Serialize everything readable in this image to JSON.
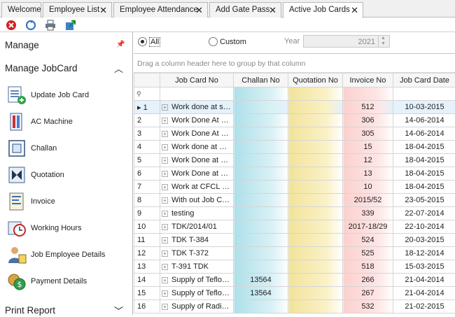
{
  "tabs": [
    {
      "label": "Welcome"
    },
    {
      "label": "Employee List"
    },
    {
      "label": "Employee Attendance"
    },
    {
      "label": "Add Gate Pass"
    },
    {
      "label": "Active Job Cards"
    }
  ],
  "sidebar": {
    "title": "Manage",
    "group": "Manage JobCard",
    "items": [
      {
        "label": "Update Job Card",
        "icon": "update-job-card-icon"
      },
      {
        "label": "AC Machine",
        "icon": "ac-machine-icon"
      },
      {
        "label": "Challan",
        "icon": "challan-icon"
      },
      {
        "label": "Quotation",
        "icon": "quotation-icon"
      },
      {
        "label": "Invoice",
        "icon": "invoice-icon"
      },
      {
        "label": "Working Hours",
        "icon": "working-hours-icon"
      },
      {
        "label": "Job Employee Details",
        "icon": "job-employee-details-icon"
      },
      {
        "label": "Payment Details",
        "icon": "payment-details-icon"
      }
    ],
    "print_report": "Print Report"
  },
  "filter": {
    "all_label": "All",
    "custom_label": "Custom",
    "year_label": "Year",
    "year_value": "2021",
    "selected": "All"
  },
  "grid": {
    "group_hint": "Drag a column header here to group by that column",
    "columns": [
      "Job Card No",
      "Challan No",
      "Quotation No",
      "Invoice No",
      "Job Card Date"
    ],
    "rows": [
      {
        "n": "1",
        "jc": "Work done at site",
        "ch": "",
        "qu": "",
        "inv": "512",
        "date": "10-03-2015"
      },
      {
        "n": "2",
        "jc": "Work Done At Plant",
        "ch": "",
        "qu": "",
        "inv": "306",
        "date": "14-06-2014"
      },
      {
        "n": "3",
        "jc": "Work Done At Plant",
        "ch": "",
        "qu": "",
        "inv": "305",
        "date": "14-06-2014"
      },
      {
        "n": "4",
        "jc": "Work done at CFCL",
        "ch": "",
        "qu": "",
        "inv": "15",
        "date": "18-04-2015"
      },
      {
        "n": "5",
        "jc": "Work Done at CFCL",
        "ch": "",
        "qu": "",
        "inv": "12",
        "date": "18-04-2015"
      },
      {
        "n": "6",
        "jc": "Work Done at CFCL",
        "ch": "",
        "qu": "",
        "inv": "13",
        "date": "18-04-2015"
      },
      {
        "n": "7",
        "jc": "Work at CFCL Site",
        "ch": "",
        "qu": "",
        "inv": "10",
        "date": "18-04-2015"
      },
      {
        "n": "8",
        "jc": "With out Job Card",
        "ch": "",
        "qu": "",
        "inv": "2015/52",
        "date": "23-05-2015"
      },
      {
        "n": "9",
        "jc": "testing",
        "ch": "",
        "qu": "",
        "inv": "339",
        "date": "22-07-2014"
      },
      {
        "n": "10",
        "jc": "TDK/2014/01",
        "ch": "",
        "qu": "",
        "inv": "2017-18/29",
        "date": "22-10-2014"
      },
      {
        "n": "11",
        "jc": "TDK T-384",
        "ch": "",
        "qu": "",
        "inv": "524",
        "date": "20-03-2015"
      },
      {
        "n": "12",
        "jc": "TDK T-372",
        "ch": "",
        "qu": "",
        "inv": "525",
        "date": "18-12-2014"
      },
      {
        "n": "13",
        "jc": "T-391 TDK",
        "ch": "",
        "qu": "",
        "inv": "518",
        "date": "15-03-2015"
      },
      {
        "n": "14",
        "jc": "Supply of Teflon Gasket",
        "ch": "13564",
        "qu": "",
        "inv": "266",
        "date": "21-04-2014"
      },
      {
        "n": "15",
        "jc": "Supply of Teflon Gasket",
        "ch": "13564",
        "qu": "",
        "inv": "267",
        "date": "21-04-2014"
      },
      {
        "n": "16",
        "jc": "Supply of Radiation",
        "ch": "",
        "qu": "",
        "inv": "532",
        "date": "21-02-2015"
      }
    ]
  }
}
